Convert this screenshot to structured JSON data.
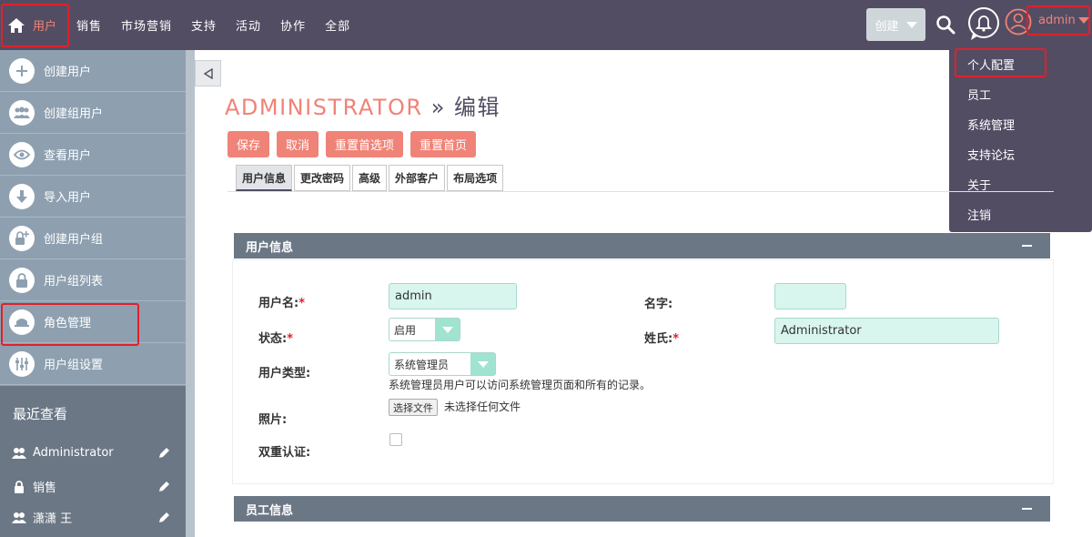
{
  "topbar": {
    "home_label": "用户",
    "nav_items": [
      "销售",
      "市场营销",
      "支持",
      "活动",
      "协作",
      "全部"
    ],
    "create_label": "创建",
    "user_label": "admin"
  },
  "user_menu": {
    "items": [
      "个人配置",
      "员工",
      "系统管理",
      "支持论坛",
      "关于",
      "注销"
    ]
  },
  "sidebar": {
    "actions": [
      "创建用户",
      "创建组用户",
      "查看用户",
      "导入用户",
      "创建用户组",
      "用户组列表",
      "角色管理",
      "用户组设置"
    ],
    "recent_title": "最近查看",
    "recent": [
      "Administrator",
      "销售",
      "潇潇 王"
    ]
  },
  "page": {
    "title_main": "ADMINISTRATOR",
    "title_rest": " » 编辑",
    "buttons": [
      "保存",
      "取消",
      "重置首选项",
      "重置首页"
    ],
    "tabs": [
      "用户信息",
      "更改密码",
      "高级",
      "外部客户",
      "布局选项"
    ]
  },
  "panel_user": {
    "title": "用户信息",
    "username_label": "用户名:",
    "username_value": "admin",
    "firstname_label": "名字:",
    "firstname_value": "",
    "status_label": "状态:",
    "status_value": "启用",
    "lastname_label": "姓氏:",
    "lastname_value": "Administrator",
    "usertype_label": "用户类型:",
    "usertype_value": "系统管理员",
    "usertype_help": "系统管理员用户可以访问系统管理页面和所有的记录。",
    "photo_label": "照片:",
    "file_button": "选择文件",
    "file_none": "未选择任何文件",
    "twofactor_label": "双重认证:",
    "required_mark": "*"
  },
  "panel_employee": {
    "title": "员工信息"
  }
}
